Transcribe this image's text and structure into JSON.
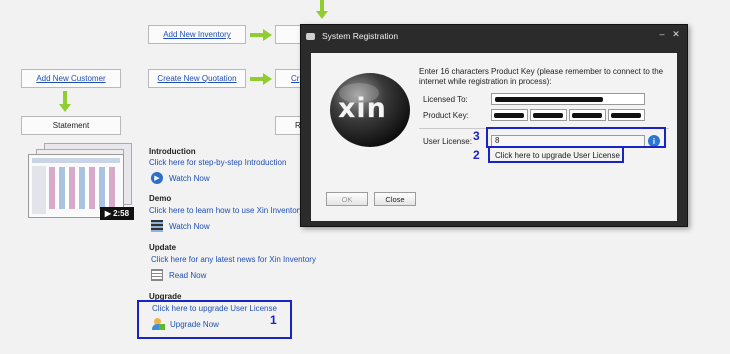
{
  "flow": {
    "add_inventory": "Add New Inventory",
    "add_customer": "Add New Customer",
    "create_quotation": "Create New Quotation",
    "cr_partial": "Cr",
    "statement": "Statement",
    "r_partial": "R"
  },
  "video": {
    "duration": "2:58"
  },
  "sections": {
    "intro": {
      "title": "Introduction",
      "link": "Click here for step-by-step Introduction",
      "action": "Watch Now"
    },
    "demo": {
      "title": "Demo",
      "link": "Click here to learn how to use Xin Inventory v",
      "action": "Watch Now"
    },
    "update": {
      "title": "Update",
      "link": "Click here for any latest news for Xin Inventory",
      "action": "Read Now"
    },
    "upgrade": {
      "title": "Upgrade",
      "link": "Click here to upgrade User License",
      "action": "Upgrade Now"
    }
  },
  "dialog": {
    "title": "System Registration",
    "logo_text": "xin",
    "instructions": "Enter 16 characters Product Key (please remember to connect to the internet while registration in process):",
    "licensed_to_label": "Licensed To:",
    "product_key_label": "Product Key:",
    "user_license_label": "User License:",
    "user_license_value": "8",
    "upgrade_link": "Click here to upgrade User License",
    "ok_label": "OK",
    "close_label": "Close"
  },
  "annotations": {
    "n1": "1",
    "n2": "2",
    "n3": "3"
  },
  "colors": {
    "highlight": "#1a24c4",
    "arrow": "#8fce2e",
    "link": "#1f4fb5",
    "dialog_frame": "#2b2b2b"
  }
}
